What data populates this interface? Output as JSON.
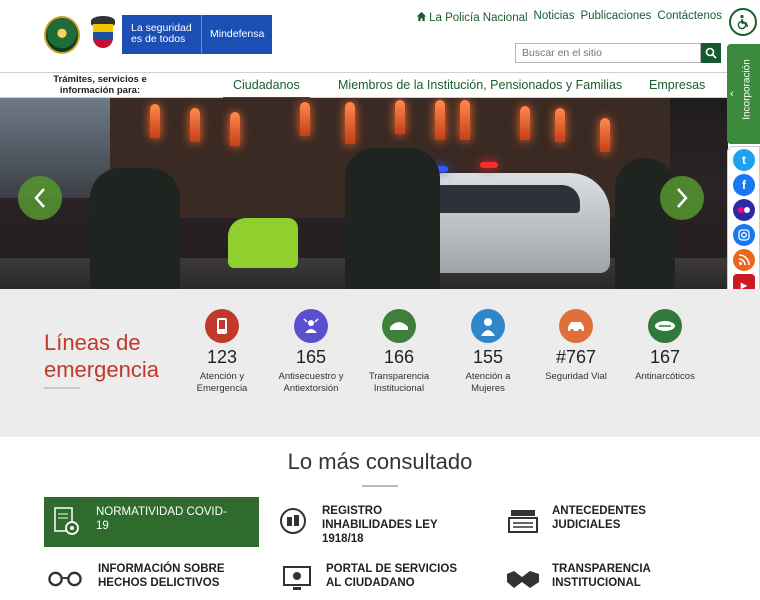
{
  "header": {
    "gov_text": "La seguridad es de todos",
    "ministry": "Mindefensa",
    "topnav": [
      "La Policía Nacional",
      "Noticias",
      "Publicaciones",
      "Contáctenos"
    ],
    "search_placeholder": "Buscar en el sitio"
  },
  "menu": {
    "intro": "Trámites, servicios e información para:",
    "items": [
      "Ciudadanos",
      "Miembros de la Institución, Pensionados y Familias",
      "Empresas"
    ]
  },
  "sidebar": {
    "incorporacion": "Incorporación",
    "social": [
      "twitter-icon",
      "facebook-icon",
      "flickr-icon",
      "instagram-icon",
      "rss-icon",
      "youtube-icon"
    ]
  },
  "emergency": {
    "title": "Líneas de emergencia",
    "lines": [
      {
        "num": "123",
        "label": "Atención y Emergencia",
        "color": "#c0392b"
      },
      {
        "num": "165",
        "label": "Antisecuestro y Antiextorsión",
        "color": "#5a4fcf"
      },
      {
        "num": "166",
        "label": "Transparencia Institucional",
        "color": "#3f7f3a"
      },
      {
        "num": "155",
        "label": "Atención a Mujeres",
        "color": "#2f87c9"
      },
      {
        "num": "#767",
        "label": "Seguridad Vial",
        "color": "#e0703a"
      },
      {
        "num": "167",
        "label": "Antinarcóticos",
        "color": "#2f7a3a"
      }
    ]
  },
  "consulted": {
    "title": "Lo más consultado",
    "items": [
      {
        "label": "NORMATIVIDAD COVID-19"
      },
      {
        "label": "REGISTRO INHABILIDADES LEY 1918/18"
      },
      {
        "label": "ANTECEDENTES JUDICIALES"
      },
      {
        "label": "INFORMACIÓN SOBRE HECHOS DELICTIVOS"
      },
      {
        "label": "PORTAL DE SERVICIOS AL CIUDADANO"
      },
      {
        "label": "TRANSPARENCIA INSTITUCIONAL"
      }
    ]
  },
  "colors": {
    "brand_green": "#1a5c2e",
    "gov_blue": "#1b4fb4",
    "emergency_red": "#c0392b"
  }
}
